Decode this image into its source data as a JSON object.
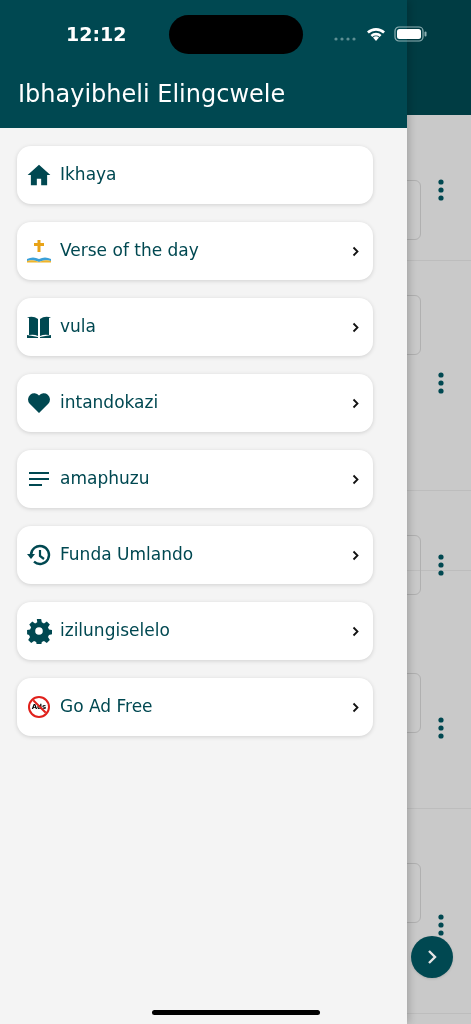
{
  "status_bar": {
    "time": "12:12"
  },
  "drawer": {
    "title": "Ibhayibheli Elingcwele",
    "items": [
      {
        "kind": "home",
        "label": "Ikhaya",
        "chevron": false
      },
      {
        "kind": "verse",
        "label": "Verse of the day",
        "chevron": true
      },
      {
        "kind": "book",
        "label": "vula",
        "chevron": true
      },
      {
        "kind": "heart",
        "label": "intandokazi",
        "chevron": true
      },
      {
        "kind": "lines",
        "label": "amaphuzu",
        "chevron": true
      },
      {
        "kind": "history",
        "label": "Funda Umlando",
        "chevron": true
      },
      {
        "kind": "gear",
        "label": "izilungiselelo",
        "chevron": true
      },
      {
        "kind": "noads",
        "label": "Go Ad Free",
        "chevron": true,
        "icon_text": "Ads"
      }
    ]
  }
}
